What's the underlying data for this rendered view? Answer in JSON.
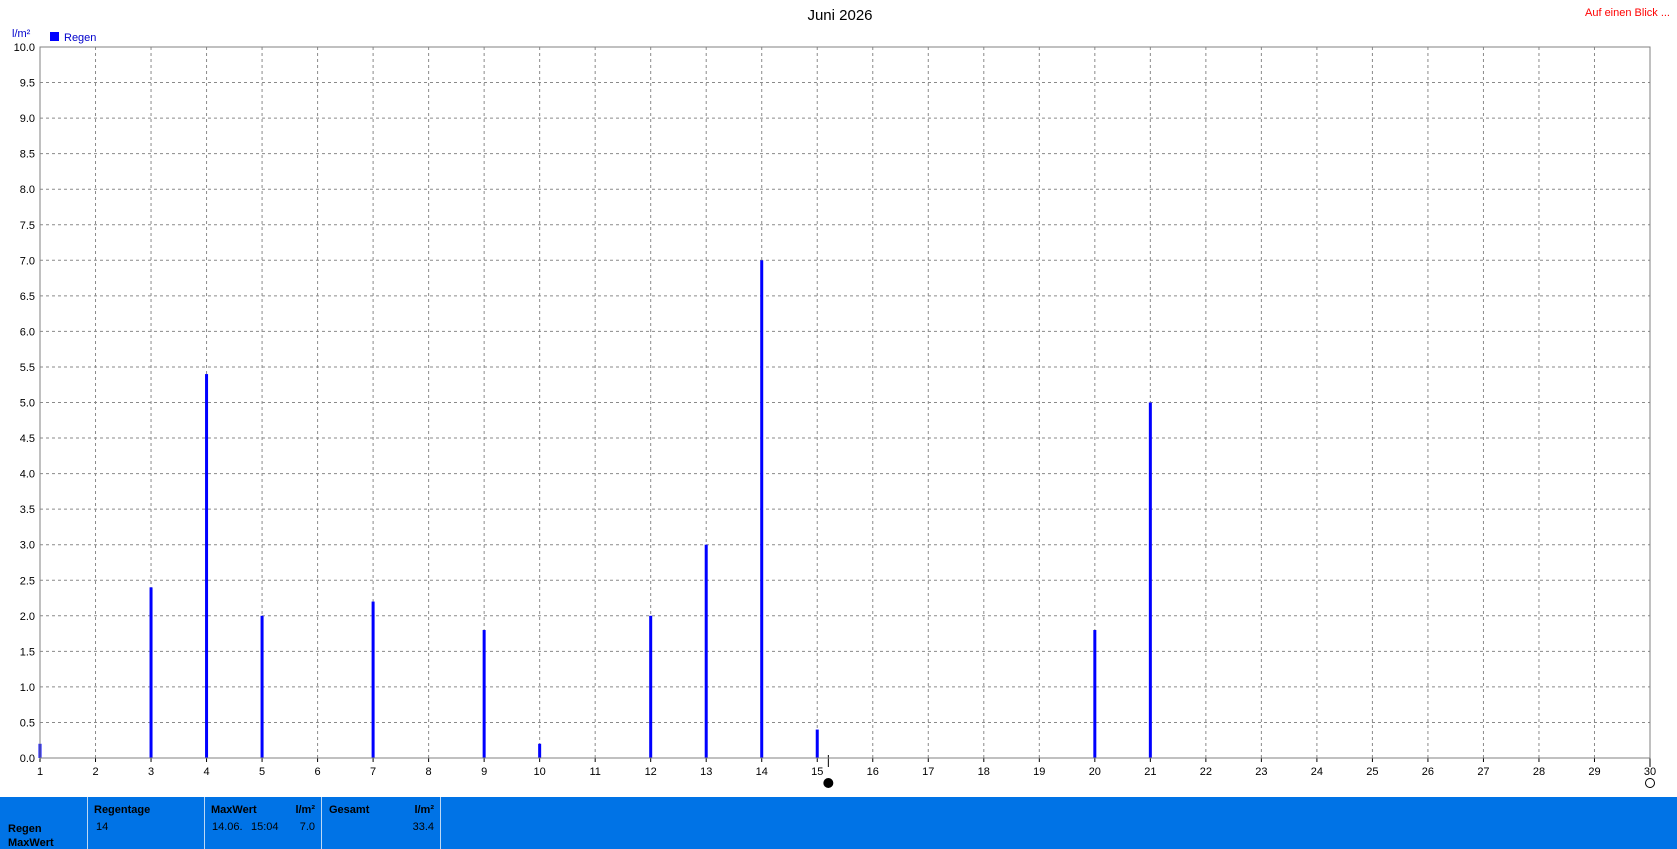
{
  "chart_data": {
    "type": "bar",
    "title": "Juni 2026",
    "ylabel": "l/m²",
    "legend": [
      {
        "name": "Regen",
        "color": "#0000ff"
      }
    ],
    "legend_position": "top-left",
    "grid": true,
    "xlim": [
      1,
      30
    ],
    "ylim": [
      0,
      10
    ],
    "x_ticks": [
      "1",
      "2",
      "3",
      "4",
      "5",
      "6",
      "7",
      "8",
      "9",
      "10",
      "11",
      "12",
      "13",
      "14",
      "15",
      "16",
      "17",
      "18",
      "19",
      "20",
      "21",
      "22",
      "23",
      "24",
      "25",
      "26",
      "27",
      "28",
      "29",
      "30"
    ],
    "y_ticks": [
      "0.0",
      "0.5",
      "1.0",
      "1.5",
      "2.0",
      "2.5",
      "3.0",
      "3.5",
      "4.0",
      "4.5",
      "5.0",
      "5.5",
      "6.0",
      "6.5",
      "7.0",
      "7.5",
      "8.0",
      "8.5",
      "9.0",
      "9.5",
      "10.0"
    ],
    "series": [
      {
        "name": "Regen",
        "color": "#0000ff",
        "points": [
          {
            "x": 1,
            "y": 0.2
          },
          {
            "x": 3,
            "y": 2.4
          },
          {
            "x": 4,
            "y": 5.4
          },
          {
            "x": 5,
            "y": 2.0
          },
          {
            "x": 7,
            "y": 2.2
          },
          {
            "x": 9,
            "y": 1.8
          },
          {
            "x": 10,
            "y": 0.2
          },
          {
            "x": 12,
            "y": 2.0
          },
          {
            "x": 13,
            "y": 3.0
          },
          {
            "x": 14,
            "y": 7.0
          },
          {
            "x": 15,
            "y": 0.4
          },
          {
            "x": 20,
            "y": 1.8
          },
          {
            "x": 21,
            "y": 5.0
          }
        ]
      }
    ],
    "markers": [
      {
        "name": "moon-full-icon",
        "x": 15.2
      },
      {
        "name": "moon-new-icon",
        "x": 30
      }
    ]
  },
  "top_right_link": "Auf einen Blick ...",
  "stats": {
    "row_labels": [
      "Regen",
      "MaxWert"
    ],
    "regentage": {
      "header": "Regentage",
      "value": "14"
    },
    "maxwert": {
      "header": "MaxWert",
      "unit": "l/m²",
      "date": "14.06.",
      "time": "15:04",
      "value": "7.0"
    },
    "gesamt": {
      "header": "Gesamt",
      "unit": "l/m²",
      "value": "33.4"
    }
  }
}
